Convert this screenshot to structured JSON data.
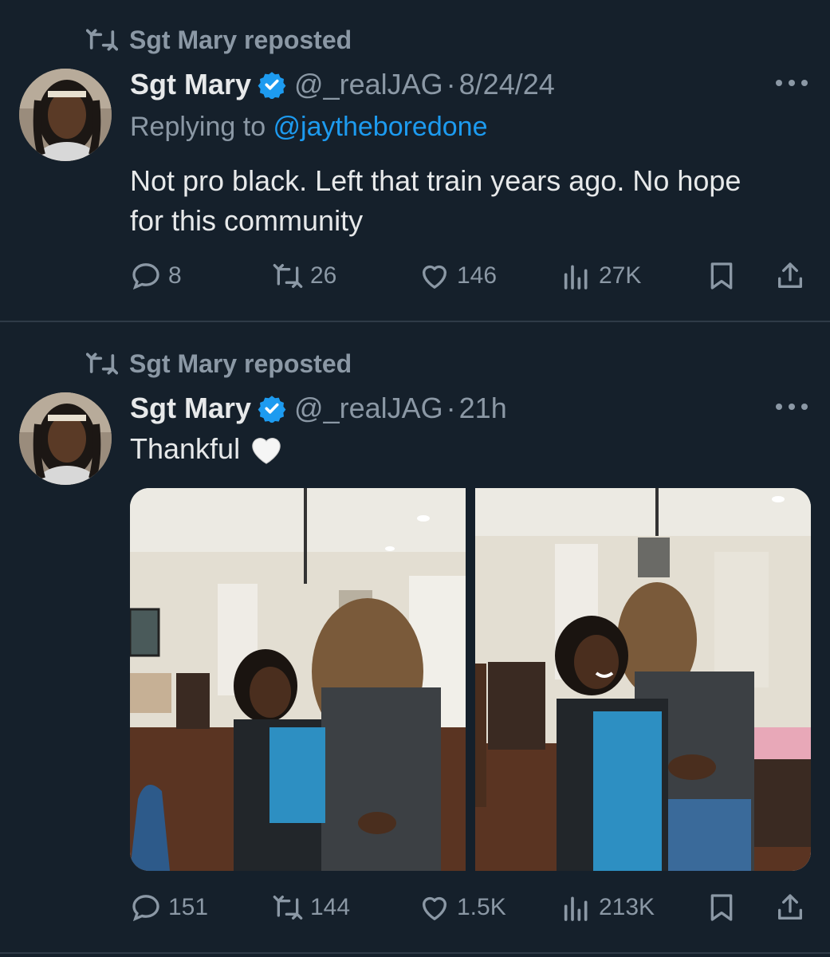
{
  "tweets": [
    {
      "repost_label": "Sgt Mary reposted",
      "display_name": "Sgt Mary",
      "handle": "@_realJAG",
      "separator": "·",
      "date": "8/24/24",
      "replying_prefix": "Replying to ",
      "replying_to": "@jaytheboredone",
      "text_line1": "Not pro black. Left that train years ago. No hope",
      "text_line2": "for this community",
      "replies": "8",
      "reposts": "26",
      "likes": "146",
      "views": "27K"
    },
    {
      "repost_label": "Sgt Mary reposted",
      "display_name": "Sgt Mary",
      "handle": "@_realJAG",
      "separator": "·",
      "date": "21h",
      "text": "Thankful",
      "emoji": "white-heart",
      "replies": "151",
      "reposts": "144",
      "likes": "1.5K",
      "views": "213K"
    }
  ],
  "colors": {
    "background": "#15202b",
    "text_primary": "#e7e9ea",
    "text_secondary": "#8b98a5",
    "accent": "#1d9bf0",
    "divider": "#2f3b47"
  },
  "icons": [
    "repost-icon",
    "verified-badge-icon",
    "more-icon",
    "reply-icon",
    "like-icon",
    "views-icon",
    "bookmark-icon",
    "share-icon"
  ]
}
